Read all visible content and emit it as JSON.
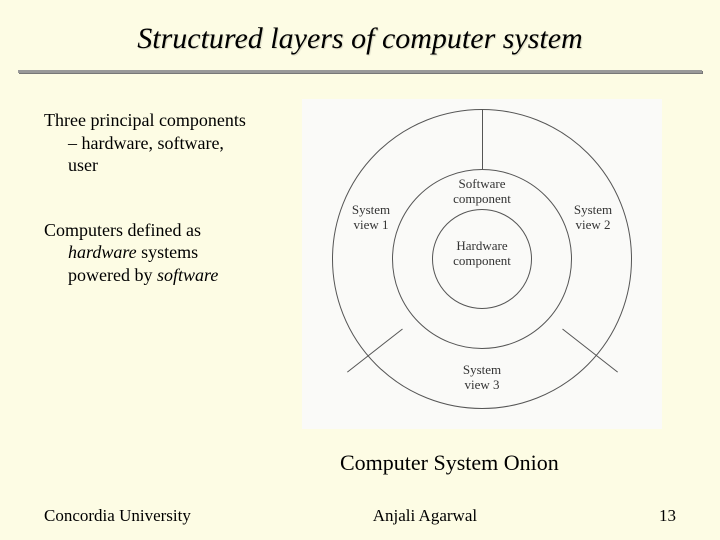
{
  "title": "Structured layers of computer system",
  "bullets": {
    "p1_line1": "Three principal components",
    "p1_line2": "– hardware, software,",
    "p1_line3": "user",
    "p2_line1": "Computers defined as",
    "p2_line2a": "hardware",
    "p2_line2b": " systems",
    "p2_line3a": "powered by ",
    "p2_line3b": "software"
  },
  "diagram": {
    "system_view_1": "System view 1",
    "system_view_2": "System view 2",
    "system_view_3": "System view 3",
    "software_component": "Software component",
    "hardware_component": "Hardware component"
  },
  "caption": "Computer System Onion",
  "footer": {
    "left": "Concordia University",
    "center": "Anjali Agarwal",
    "right": "13"
  }
}
